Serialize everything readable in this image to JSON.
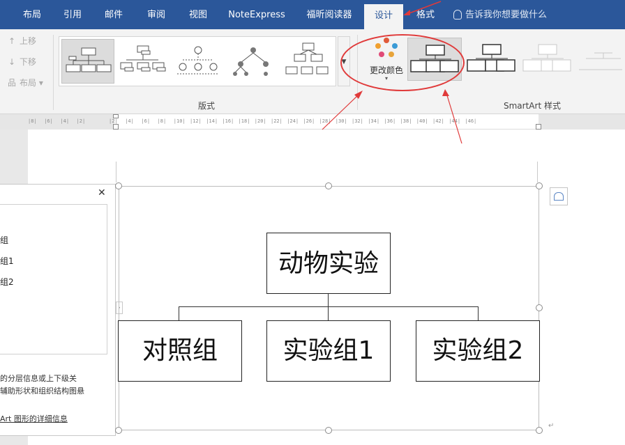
{
  "tabs": [
    {
      "key": "layout",
      "label": "布局"
    },
    {
      "key": "references",
      "label": "引用"
    },
    {
      "key": "mailings",
      "label": "邮件"
    },
    {
      "key": "review",
      "label": "审阅"
    },
    {
      "key": "view",
      "label": "视图"
    },
    {
      "key": "noteexpress",
      "label": "NoteExpress"
    },
    {
      "key": "foxit",
      "label": "福昕阅读器"
    },
    {
      "key": "design",
      "label": "设计",
      "active": true
    },
    {
      "key": "format",
      "label": "格式"
    }
  ],
  "tell_me": "告诉我你想要做什么",
  "ribbon": {
    "create_graphic": {
      "move_up": "上移",
      "move_down": "下移",
      "layout": "布局"
    },
    "layouts_group_label": "版式",
    "change_colors_label": "更改颜色",
    "smartart_styles_label": "SmartArt 样式"
  },
  "ruler_ticks": [
    "8",
    "6",
    "4",
    "2",
    "",
    "2",
    "4",
    "6",
    "8",
    "10",
    "12",
    "14",
    "16",
    "18",
    "20",
    "22",
    "24",
    "26",
    "28",
    "30",
    "32",
    "34",
    "36",
    "38",
    "40",
    "42",
    "44",
    "46"
  ],
  "text_pane": {
    "items": [
      "组",
      "组1",
      "组2"
    ],
    "description": "的分层信息或上下级关辅助形状和组织结构图悬",
    "description_lines": [
      "的分层信息或上下级关",
      "辅助形状和组织结构图悬"
    ],
    "more_link": "Art 图形的详细信息"
  },
  "smartart": {
    "root": "动物实验",
    "children": [
      "对照组",
      "实验组1",
      "实验组2"
    ]
  },
  "colors": {
    "ribbon_blue": "#2b579a",
    "annotation_red": "#e03a3a"
  }
}
